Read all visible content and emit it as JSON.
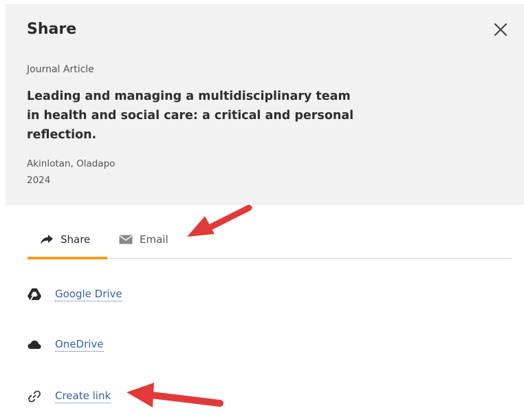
{
  "dialog": {
    "title": "Share",
    "close_icon": "close-icon"
  },
  "item": {
    "type": "Journal Article",
    "title": "Leading and managing a multidisciplinary team in health and social care: a critical and personal reflection.",
    "author": "Akinlotan, Oladapo",
    "year": "2024"
  },
  "tabs": [
    {
      "label": "Share",
      "icon": "share-arrow-icon",
      "active": true
    },
    {
      "label": "Email",
      "icon": "envelope-icon",
      "active": false
    }
  ],
  "share_options": [
    {
      "label": "Google Drive",
      "icon": "google-drive-icon"
    },
    {
      "label": "OneDrive",
      "icon": "cloud-icon"
    },
    {
      "label": "Create link",
      "icon": "link-icon"
    }
  ],
  "colors": {
    "header_bg": "#f2f2f2",
    "active_tab_accent": "#f0a01d",
    "link": "#3a5fa8",
    "annotation_arrow": "#e03a3a"
  }
}
